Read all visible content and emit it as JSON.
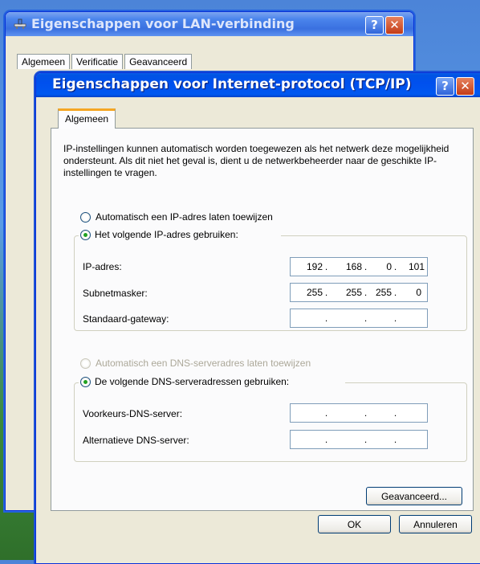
{
  "back_window": {
    "title": "Eigenschappen voor LAN-verbinding",
    "tabs": [
      "Algemeen",
      "Verificatie",
      "Geavanceerd"
    ]
  },
  "dialog": {
    "title": "Eigenschappen voor Internet-protocol (TCP/IP)",
    "tab": "Algemeen",
    "intro": "IP-instellingen kunnen automatisch worden toegewezen als het netwerk deze mogelijkheid ondersteunt. Als dit niet het geval is, dient u de netwerkbeheerder naar de geschikte IP-instellingen te vragen.",
    "ip_auto_label": "Automatisch een IP-adres laten toewijzen",
    "ip_manual_label": "Het volgende IP-adres gebruiken:",
    "ip_fields": [
      {
        "label": "IP-adres:",
        "octets": [
          "192",
          "168",
          "0",
          "101"
        ]
      },
      {
        "label": "Subnetmasker:",
        "octets": [
          "255",
          "255",
          "255",
          "0"
        ]
      },
      {
        "label": "Standaard-gateway:",
        "octets": [
          "",
          "",
          "",
          ""
        ]
      }
    ],
    "dns_auto_label": "Automatisch een DNS-serveradres laten toewijzen",
    "dns_manual_label": "De volgende DNS-serveradressen gebruiken:",
    "dns_fields": [
      {
        "label": "Voorkeurs-DNS-server:",
        "octets": [
          "",
          "",
          "",
          ""
        ]
      },
      {
        "label": "Alternatieve DNS-server:",
        "octets": [
          "",
          "",
          "",
          ""
        ]
      }
    ],
    "advanced_button": "Geavanceerd...",
    "ok_button": "OK",
    "cancel_button": "Annuleren",
    "help_glyph": "?",
    "close_glyph": "✕"
  }
}
